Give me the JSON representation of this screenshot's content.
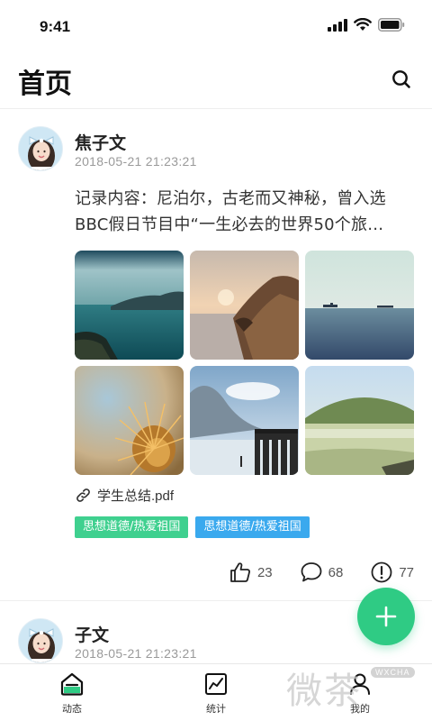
{
  "status_bar": {
    "time": "9:41"
  },
  "header": {
    "title": "首页",
    "search_icon": "search-icon"
  },
  "posts": [
    {
      "author": "焦子文",
      "time": "2018-05-21   21:23:21",
      "content_lines": [
        "记录内容：尼泊尔，古老而又神秘，曾入选",
        "BBC假日节目中“一生必去的世界50个旅…"
      ],
      "photos": [
        "lake-cliffs-photo",
        "sunset-coast-photo",
        "sea-ships-photo",
        "cactus-closeup-photo",
        "mountain-pier-photo",
        "misty-hill-photo"
      ],
      "attachment": {
        "icon": "link-icon",
        "name": "学生总结.pdf"
      },
      "tags": [
        {
          "label": "思想道德/热爱祖国",
          "color": "#3fd08f"
        },
        {
          "label": "思想道德/热爱祖国",
          "color": "#3aa9ee"
        }
      ],
      "stats": {
        "likes": "23",
        "comments": "68",
        "reports": "77"
      }
    },
    {
      "author": "子文",
      "time": "2018-05-21   21:23:21"
    }
  ],
  "fab": {
    "icon": "plus-icon"
  },
  "tab_bar": {
    "items": [
      {
        "label": "动态",
        "icon": "home-icon"
      },
      {
        "label": "统计",
        "icon": "chart-icon"
      },
      {
        "label": "我的",
        "icon": "user-icon"
      }
    ]
  },
  "watermark": {
    "text": "微茶",
    "badge": "WXCHA"
  },
  "colors": {
    "accent": "#2fcb84",
    "tag_green": "#3fd08f",
    "tag_blue": "#3aa9ee"
  }
}
